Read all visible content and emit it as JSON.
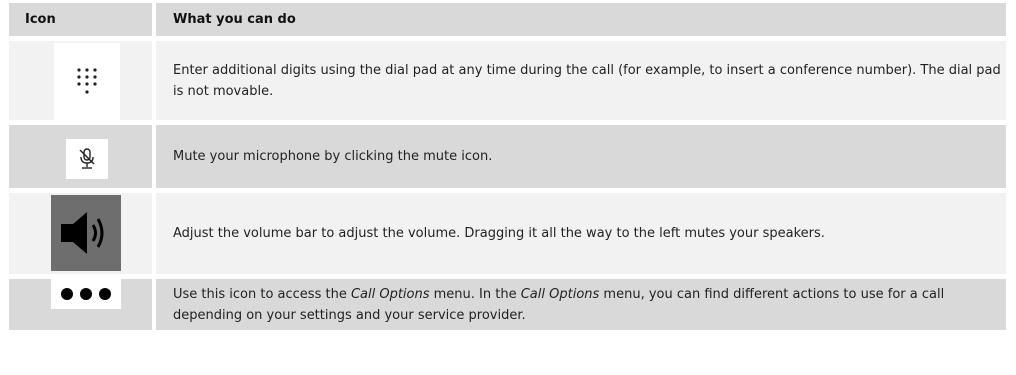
{
  "header": {
    "col_icon": "Icon",
    "col_action": "What you can do"
  },
  "rows": [
    {
      "icon": "dial-pad-icon",
      "text": "Enter additional digits using the dial pad at any time during the call (for example, to insert a conference number). The dial pad is not movable."
    },
    {
      "icon": "mute-microphone-icon",
      "text": "Mute your microphone by clicking the mute icon."
    },
    {
      "icon": "volume-speaker-icon",
      "text": "Adjust the volume bar to adjust the volume. Dragging it all the way to the left mutes your speakers."
    },
    {
      "icon": "more-options-icon",
      "text_parts": [
        "Use this icon to access the ",
        "Call Options",
        " menu. In the ",
        "Call Options",
        " menu, you can find different actions to use for a call depending on your settings and your service provider."
      ]
    }
  ],
  "colors": {
    "header_bg": "#d9d9d9",
    "row_light": "#f2f2f2",
    "row_dark": "#d9d9d9",
    "speaker_bg": "#6e6e6e"
  }
}
